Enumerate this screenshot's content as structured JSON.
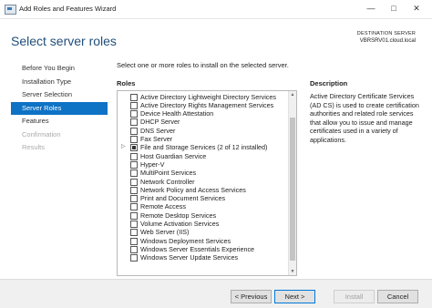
{
  "window": {
    "title": "Add Roles and Features Wizard"
  },
  "header": {
    "page_title": "Select server roles",
    "destination_label": "DESTINATION SERVER",
    "destination_value": "VBRSRV01.cloud.local"
  },
  "nav": {
    "items": [
      {
        "label": "Before You Begin",
        "state": "normal"
      },
      {
        "label": "Installation Type",
        "state": "normal"
      },
      {
        "label": "Server Selection",
        "state": "normal"
      },
      {
        "label": "Server Roles",
        "state": "selected"
      },
      {
        "label": "Features",
        "state": "normal"
      },
      {
        "label": "Confirmation",
        "state": "disabled"
      },
      {
        "label": "Results",
        "state": "disabled"
      }
    ]
  },
  "main": {
    "instruction": "Select one or more roles to install on the selected server.",
    "roles_label": "Roles",
    "description_label": "Description",
    "description_text": "Active Directory Certificate Services (AD CS) is used to create certification authorities and related role services that allow you to issue and manage certificates used in a variety of applications.",
    "roles": [
      {
        "label": "Active Directory Lightweight Directory Services",
        "checked": false,
        "expandable": false
      },
      {
        "label": "Active Directory Rights Management Services",
        "checked": false,
        "expandable": false
      },
      {
        "label": "Device Health Attestation",
        "checked": false,
        "expandable": false
      },
      {
        "label": "DHCP Server",
        "checked": false,
        "expandable": false
      },
      {
        "label": "DNS Server",
        "checked": false,
        "expandable": false
      },
      {
        "label": "Fax Server",
        "checked": false,
        "expandable": false
      },
      {
        "label": "File and Storage Services (2 of 12 installed)",
        "checked": true,
        "expandable": true
      },
      {
        "label": "Host Guardian Service",
        "checked": false,
        "expandable": false
      },
      {
        "label": "Hyper-V",
        "checked": false,
        "expandable": false
      },
      {
        "label": "MultiPoint Services",
        "checked": false,
        "expandable": false
      },
      {
        "label": "Network Controller",
        "checked": false,
        "expandable": false
      },
      {
        "label": "Network Policy and Access Services",
        "checked": false,
        "expandable": false
      },
      {
        "label": "Print and Document Services",
        "checked": false,
        "expandable": false
      },
      {
        "label": "Remote Access",
        "checked": false,
        "expandable": false
      },
      {
        "label": "Remote Desktop Services",
        "checked": false,
        "expandable": false
      },
      {
        "label": "Volume Activation Services",
        "checked": false,
        "expandable": false
      },
      {
        "label": "Web Server (IIS)",
        "checked": false,
        "expandable": false
      },
      {
        "label": "Windows Deployment Services",
        "checked": false,
        "expandable": false
      },
      {
        "label": "Windows Server Essentials Experience",
        "checked": false,
        "expandable": false
      },
      {
        "label": "Windows Server Update Services",
        "checked": false,
        "expandable": false
      }
    ]
  },
  "footer": {
    "previous_label": "< Previous",
    "next_label": "Next >",
    "install_label": "Install",
    "cancel_label": "Cancel"
  },
  "icons": {
    "expander": "chevron-right-icon",
    "scroll_up": "triangle-up-icon",
    "scroll_down": "triangle-down-icon"
  },
  "colors": {
    "accent": "#0e72c5",
    "title": "#1f4e79"
  }
}
